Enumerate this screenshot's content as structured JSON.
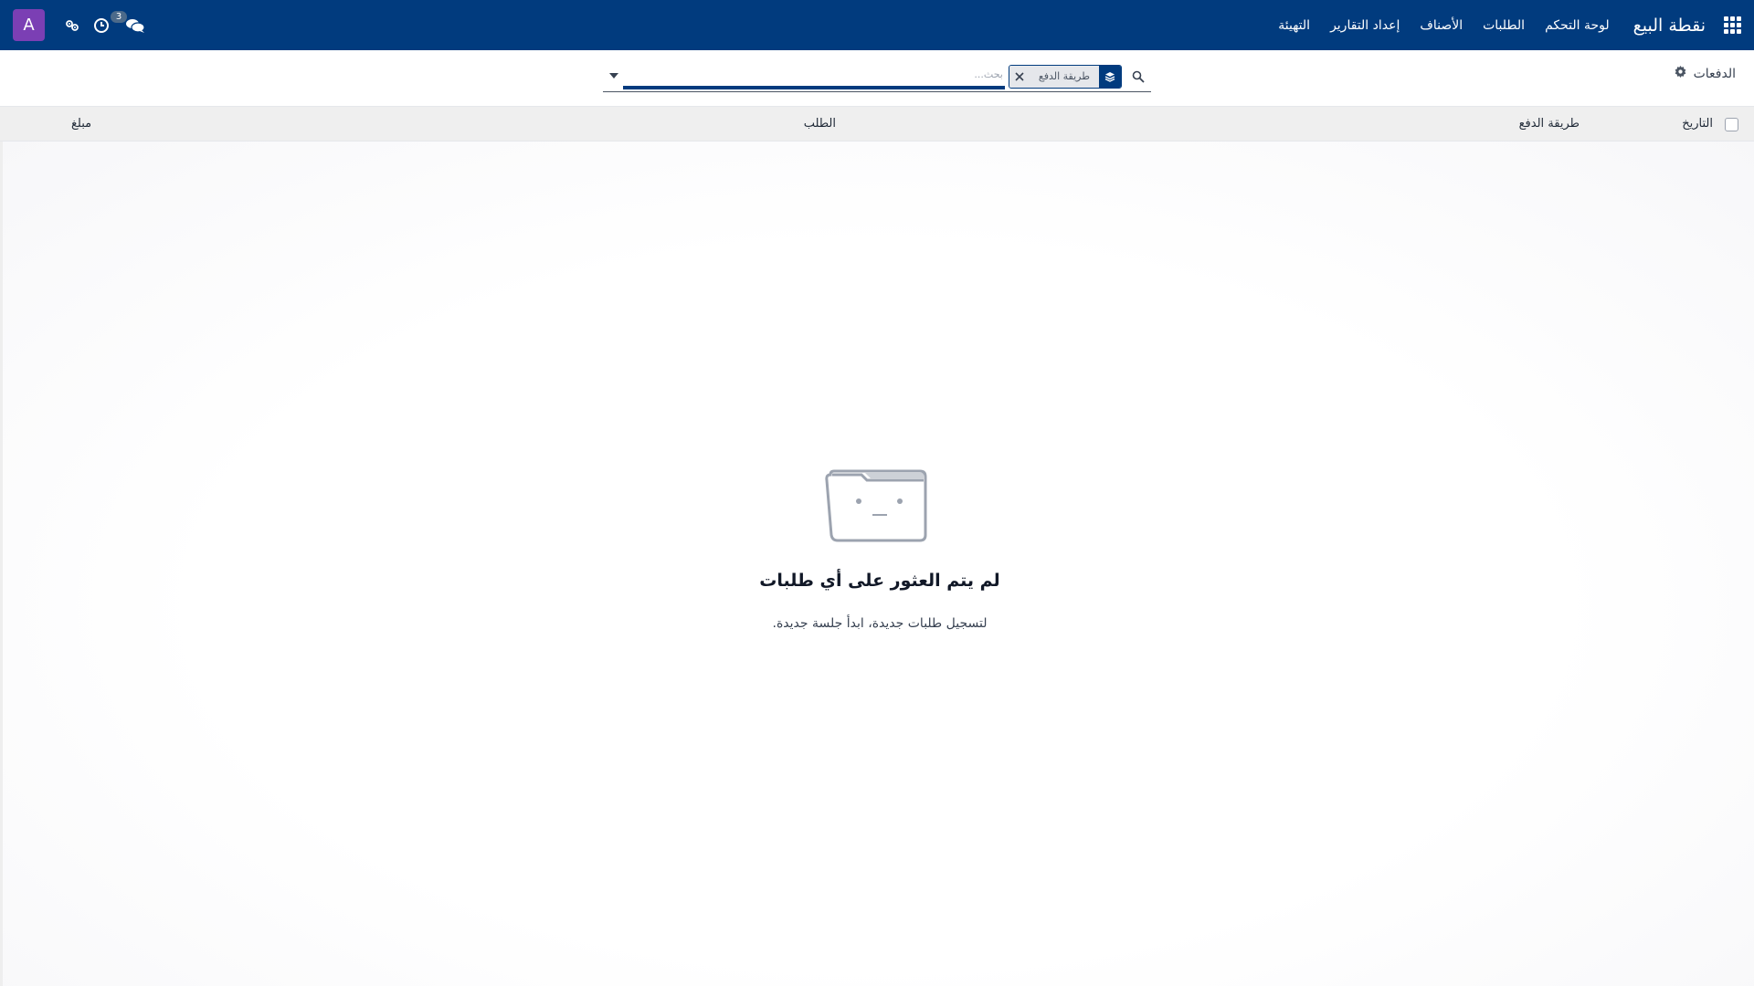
{
  "navbar": {
    "brand": "نقطة البيع",
    "menu": [
      "لوحة التحكم",
      "الطلبات",
      "الأصناف",
      "إعداد التقارير",
      "التهيئة"
    ],
    "avatar_letter": "A",
    "messages_count": "3",
    "icons": [
      "apps-grid-icon",
      "chat-icon",
      "clock-icon",
      "users-gear-icon"
    ],
    "color": "#013b7e"
  },
  "control_panel": {
    "breadcrumb": "الدفعات",
    "search": {
      "facet_label": "طريقة الدفع",
      "placeholder": "بحث...",
      "value": ""
    }
  },
  "list": {
    "columns": {
      "date": "التاريخ",
      "payment_method": "طريقة الدفع",
      "order": "الطلب",
      "amount": "مبلغ"
    }
  },
  "empty_state": {
    "title": "لم يتم العثور على أي طلبات",
    "subtitle": "لتسجيل طلبات جديدة، ابدأ جلسة جديدة."
  },
  "colors": {
    "primary": "#013b7e",
    "avatar": "#7b3fb4"
  }
}
